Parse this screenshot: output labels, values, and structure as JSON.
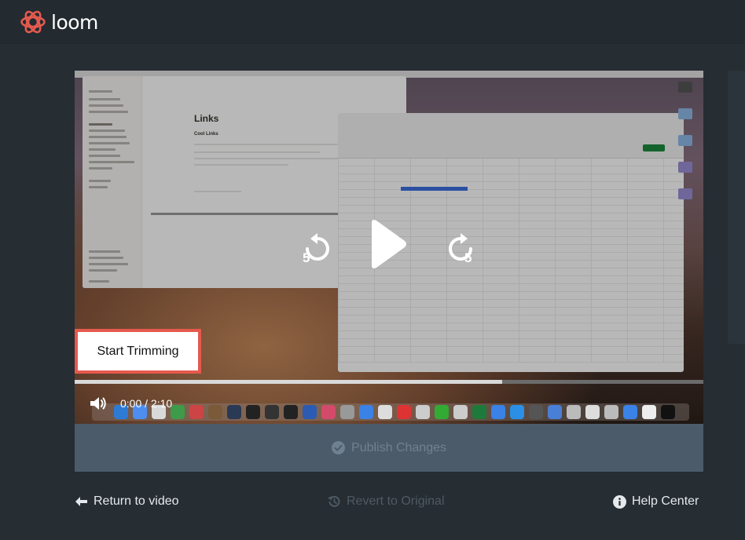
{
  "brand": {
    "name": "loom"
  },
  "player": {
    "trim_button_label": "Start Trimming",
    "current_time": "0:00",
    "time_separator": "/",
    "duration": "2:10",
    "progress_played": 0.68,
    "skip_back_seconds": "5",
    "skip_forward_seconds": "5",
    "screen_content": {
      "notion_page_title": "Links",
      "notion_subheading": "Cool Links"
    }
  },
  "publish": {
    "label": "Publish Changes"
  },
  "footer": {
    "return_label": "Return to video",
    "revert_label": "Revert to Original",
    "help_label": "Help Center"
  },
  "colors": {
    "background": "#232a30",
    "accent": "#e55a4e",
    "publish_bar": "#4b5b69",
    "publish_text_disabled": "#6f8190"
  },
  "icons": {
    "logo": "loom-logo-icon",
    "volume": "volume-icon",
    "play": "play-icon",
    "skip_back": "rewind-5-icon",
    "skip_forward": "forward-5-icon",
    "publish": "check-circle-icon",
    "return": "arrow-left-icon",
    "revert": "history-icon",
    "help": "info-icon"
  }
}
